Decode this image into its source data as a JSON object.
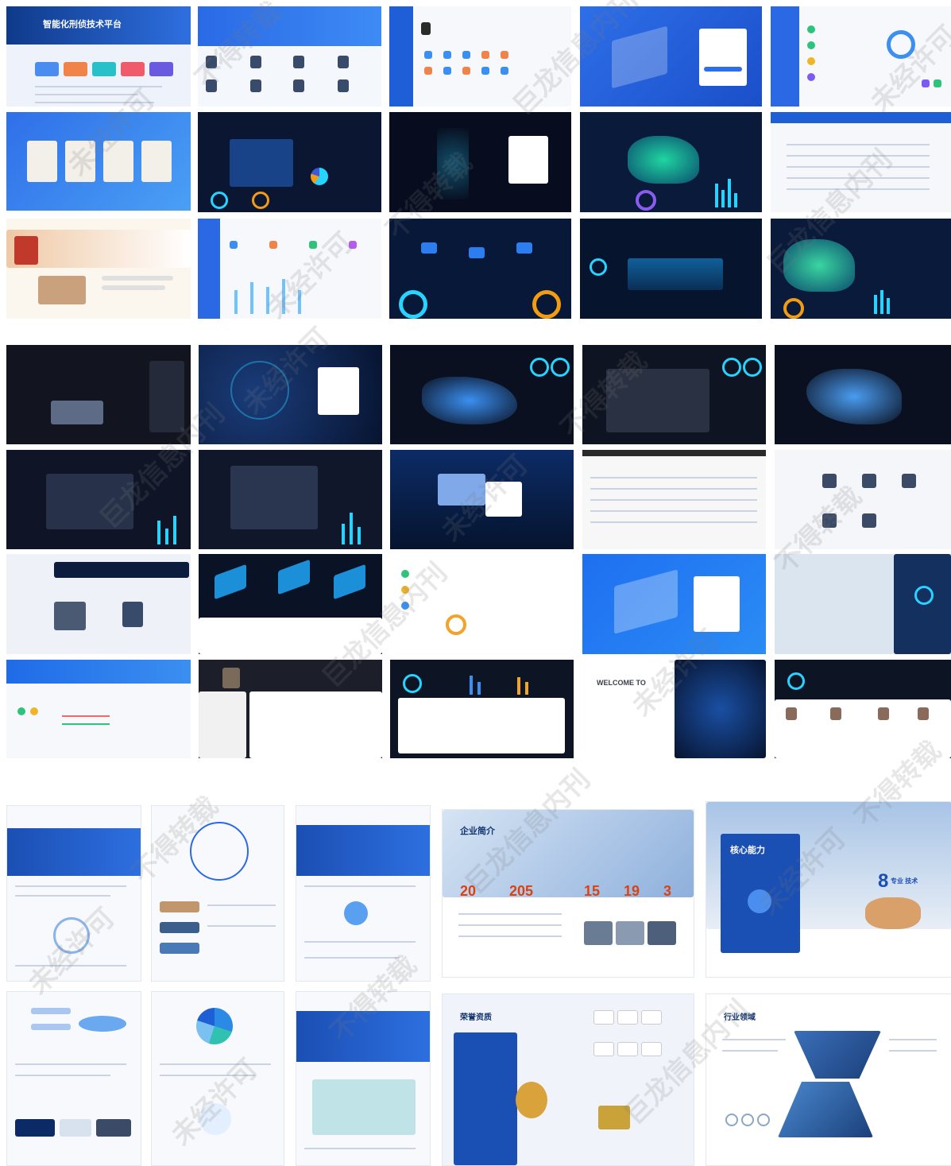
{
  "watermark_texts": [
    "巨龙信息内刊",
    "未经许可",
    "不得转载"
  ],
  "section1": {
    "tile_titles": [
      "智能化刑侦技术平台",
      "",
      "",
      "",
      "",
      "",
      "",
      "",
      "",
      "",
      "",
      "",
      "",
      "",
      ""
    ]
  },
  "section3": {
    "company_intro_title": "企业简介",
    "company_stats": [
      "20",
      "205",
      "15",
      "19",
      "3"
    ],
    "core_ability_title": "核心能力",
    "core_ability_number": "8",
    "core_ability_tag": "专业 技术",
    "honor_title": "荣誉资质",
    "industry_title": "行业领域",
    "welcome_text": "WELCOME TO",
    "brochure_titles": [
      "",
      "",
      "",
      "",
      "",
      ""
    ]
  },
  "colors": {
    "dark_bg": "#0a1632",
    "dark_panel": "#132a57",
    "accent_cyan": "#27d3ff",
    "accent_blue": "#1f5fd6",
    "accent_orange": "#f39c12",
    "light_bg": "#eef3fb"
  }
}
